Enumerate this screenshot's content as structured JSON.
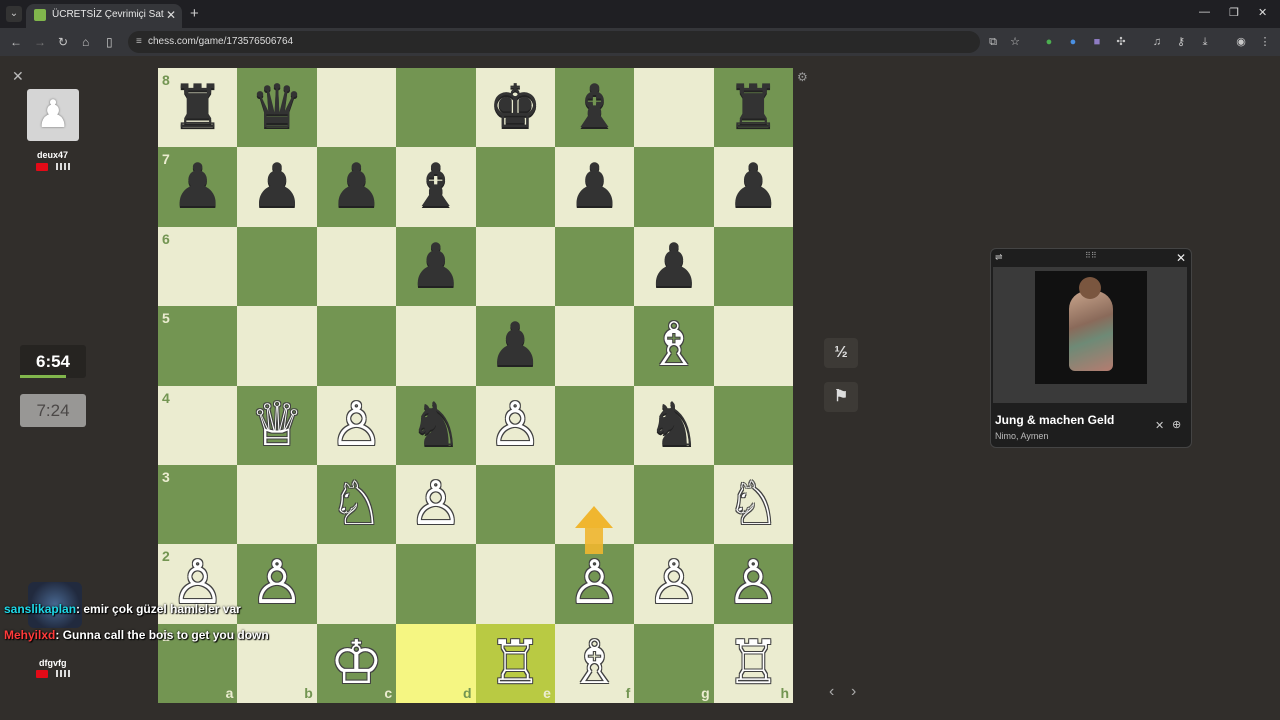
{
  "browser": {
    "tab_title": "ÜCRETSİZ Çevrimiçi Satranç Oy",
    "url": "chess.com/game/173576506764"
  },
  "players": {
    "top": {
      "name": "deux47",
      "clock": "7:24"
    },
    "bottom": {
      "name": "dfgvfg",
      "clock": "6:54"
    }
  },
  "board": {
    "ranks": [
      "8",
      "7",
      "6",
      "5",
      "4",
      "3",
      "2",
      "1"
    ],
    "files": [
      "a",
      "b",
      "c",
      "d",
      "e",
      "f",
      "g",
      "h"
    ],
    "rows": [
      [
        "♜",
        "♛",
        "",
        "",
        "♚",
        "♝",
        "",
        "♜"
      ],
      [
        "♟",
        "♟",
        "♟",
        "♝",
        "",
        "♟",
        "",
        "♟"
      ],
      [
        "",
        "",
        "",
        "♟",
        "",
        "",
        "♟",
        ""
      ],
      [
        "",
        "",
        "",
        "",
        "♟",
        "",
        "♗",
        ""
      ],
      [
        "",
        "♕",
        "♙",
        "♞",
        "♙",
        "",
        "♞",
        ""
      ],
      [
        "",
        "",
        "♘",
        "♙",
        "",
        "",
        "",
        "♘"
      ],
      [
        "♙",
        "♙",
        "",
        "",
        "",
        "♙",
        "♙",
        "♙"
      ],
      [
        "",
        "",
        "♔",
        "",
        "♖",
        "♗",
        "",
        "♖"
      ]
    ],
    "colors": [
      [
        "b",
        "b",
        "",
        "",
        "b",
        "b",
        "",
        "b"
      ],
      [
        "b",
        "b",
        "b",
        "b",
        "",
        "b",
        "",
        "b"
      ],
      [
        "",
        "",
        "",
        "b",
        "",
        "",
        "b",
        ""
      ],
      [
        "",
        "",
        "",
        "",
        "b",
        "",
        "w",
        ""
      ],
      [
        "",
        "w",
        "w",
        "b",
        "w",
        "",
        "b",
        ""
      ],
      [
        "",
        "",
        "w",
        "w",
        "",
        "",
        "",
        "w"
      ],
      [
        "w",
        "w",
        "",
        "",
        "",
        "w",
        "w",
        "w"
      ],
      [
        "",
        "",
        "w",
        "",
        "w",
        "w",
        "",
        "w"
      ]
    ],
    "light_color": "#ebecd0",
    "dark_color": "#739552",
    "highlight": [
      "d1",
      "e1"
    ]
  },
  "controls": {
    "draw_label": "½",
    "resign_icon": "flag-icon"
  },
  "music": {
    "title": "Jung & machen Geld",
    "artist": "Nimo, Aymen"
  },
  "chat": [
    {
      "user": "sanslikaplan",
      "text": ": emir çok güzel hamleler var"
    },
    {
      "user": "Mehyilxd",
      "text": ": Gunna call the bois to get you down"
    }
  ]
}
